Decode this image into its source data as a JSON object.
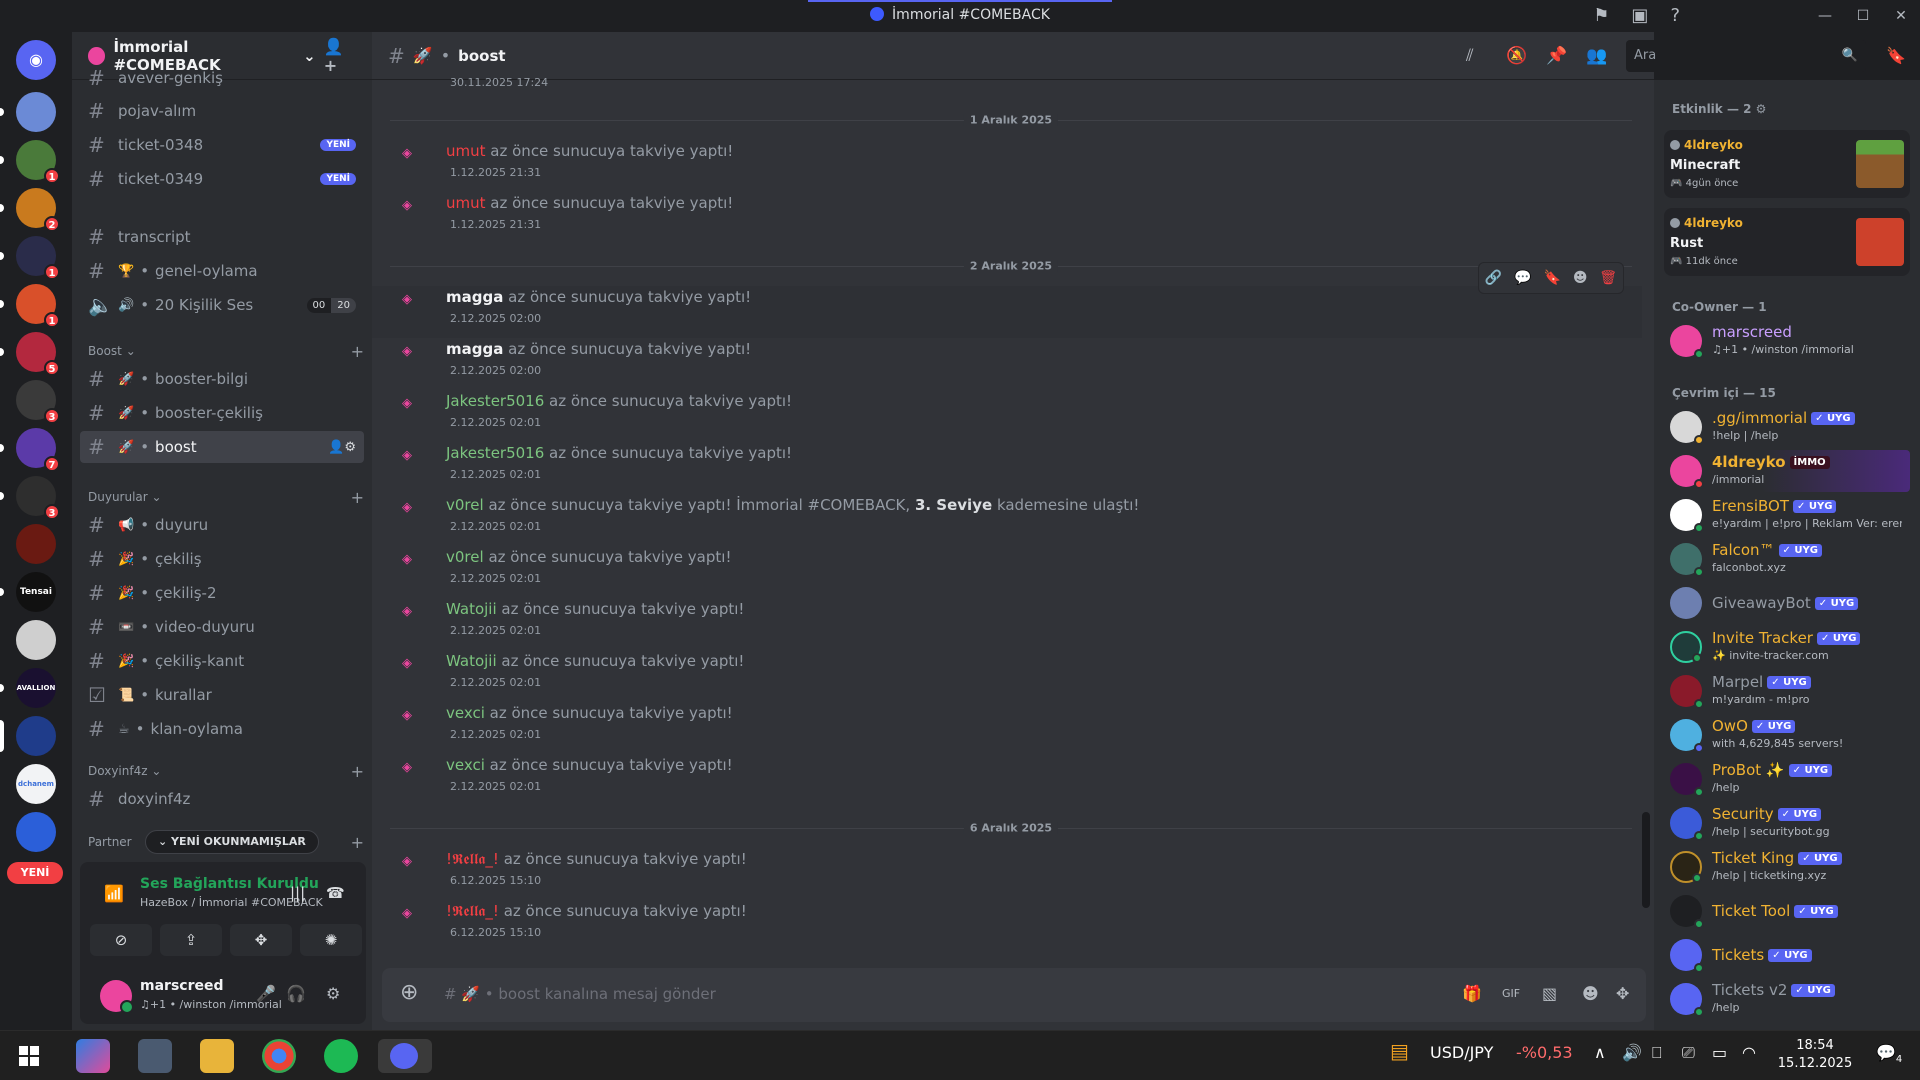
{
  "window": {
    "title": "İmmorial #COMEBACK"
  },
  "rail": {
    "badges": [
      "1",
      "2",
      "1",
      "1",
      "5",
      "3",
      "7",
      "3"
    ],
    "server_labels": [
      "Tensai",
      "AVALLION",
      "dchanem"
    ],
    "new_label": "YENİ"
  },
  "guild": {
    "name": "İmmorial #COMEBACK"
  },
  "channels": {
    "top_partial": "avever-genkiş",
    "items": [
      {
        "name": "pojav-alım"
      },
      {
        "name": "ticket-0348",
        "badge": "YENİ"
      },
      {
        "name": "ticket-0349",
        "badge": "YENİ"
      },
      {
        "name": "transcript"
      },
      {
        "name": "genel-oylama",
        "emoji": "🏆"
      },
      {
        "name": "20 Kişilik Ses",
        "emoji": "🔊",
        "vc_left": "00",
        "vc_right": "20"
      },
      {
        "name": "booster-bilgi",
        "emoji": "🚀"
      },
      {
        "name": "booster-çekiliş",
        "emoji": "🚀"
      },
      {
        "name": "boost",
        "emoji": "🚀"
      },
      {
        "name": "duyuru",
        "emoji": "📢"
      },
      {
        "name": "çekiliş",
        "emoji": "🎉"
      },
      {
        "name": "çekiliş-2",
        "emoji": "🎉"
      },
      {
        "name": "video-duyuru",
        "emoji": "📼"
      },
      {
        "name": "çekiliş-kanıt",
        "emoji": "🎉"
      },
      {
        "name": "kurallar",
        "emoji": "📜"
      },
      {
        "name": "klan-oylama",
        "emoji": "☕"
      },
      {
        "name": "doxyinf4z"
      }
    ],
    "categories": [
      "Boost",
      "Duyurular",
      "Doxyinf4z",
      "Partner"
    ],
    "unread_pill": "YENİ OKUNMAMIŞLAR"
  },
  "voice": {
    "status": "Ses Bağlantısı Kuruldu",
    "location": "HazeBox / İmmorial #COMEBACK"
  },
  "user": {
    "name": "marscreed",
    "status": "♫+1 • /winston /immorial"
  },
  "chat": {
    "channel": "boost",
    "search_placeholder": "Ara",
    "top_partial_ts": "30.11.2025 17:24",
    "dividers": [
      "1 Aralık 2025",
      "2 Aralık 2025",
      "6 Aralık 2025"
    ],
    "action_text": "az önce sunucuya takviye yaptı!",
    "level_text_1": "az önce sunucuya takviye yaptı! İmmorial #COMEBACK,",
    "level_bold": "3. Seviye",
    "level_text_2": "kademesine ulaştı!",
    "messages": [
      {
        "user": "umut",
        "color": "#f23f43",
        "ts": "1.12.2025 21:31"
      },
      {
        "user": "umut",
        "color": "#f23f43",
        "ts": "1.12.2025 21:31"
      },
      {
        "user": "magga",
        "color": "#f2f3f5",
        "ts": "2.12.2025 02:00"
      },
      {
        "user": "magga",
        "color": "#f2f3f5",
        "ts": "2.12.2025 02:00"
      },
      {
        "user": "Jakester5016",
        "color": "#7cc47f",
        "ts": "2.12.2025 02:01"
      },
      {
        "user": "Jakester5016",
        "color": "#7cc47f",
        "ts": "2.12.2025 02:01"
      },
      {
        "user": "v0rel",
        "color": "#7cc47f",
        "ts": "2.12.2025 02:01"
      },
      {
        "user": "v0rel",
        "color": "#7cc47f",
        "ts": "2.12.2025 02:01"
      },
      {
        "user": "Watojii",
        "color": "#7cc47f",
        "ts": "2.12.2025 02:01"
      },
      {
        "user": "Watojii",
        "color": "#7cc47f",
        "ts": "2.12.2025 02:01"
      },
      {
        "user": "vexci",
        "color": "#7cc47f",
        "ts": "2.12.2025 02:01"
      },
      {
        "user": "vexci",
        "color": "#7cc47f",
        "ts": "2.12.2025 02:01"
      },
      {
        "user": "!𝕽𝖊𝖑𝖑𝖆_!",
        "color": "#f23f43",
        "ts": "6.12.2025 15:10"
      },
      {
        "user": "!𝕽𝖊𝖑𝖑𝖆_!",
        "color": "#f23f43",
        "ts": "6.12.2025 15:10"
      }
    ],
    "composer_placeholder": "boost kanalına mesaj gönder"
  },
  "members": {
    "activity_header": "Etkinlik — 2",
    "activities": [
      {
        "user": "4ldreyko",
        "game": "Minecraft",
        "time": "4gün önce"
      },
      {
        "user": "4ldreyko",
        "game": "Rust",
        "time": "11dk önce"
      }
    ],
    "coowner_header": "Co-Owner — 1",
    "coowner": {
      "name": "marscreed",
      "status": "♫+1 • /winston /immorial"
    },
    "online_header": "Çevrim içi — 15",
    "list": [
      {
        "name": ".gg/immorial",
        "tag": "✓ UYG",
        "status": "!help | /help",
        "color": "#f0b232"
      },
      {
        "name": "4ldreyko",
        "tag": "İMMO",
        "status": "/immorial",
        "color": "#f0b232"
      },
      {
        "name": "ErensiBOT",
        "tag": "✓ UYG",
        "status": "e!yardım | e!pro | Reklam Ver: eren...",
        "color": "#f0b232"
      },
      {
        "name": "Falcon™",
        "tag": "✓ UYG",
        "status": "falconbot.xyz",
        "color": "#f0b232"
      },
      {
        "name": "GiveawayBot",
        "tag": "✓ UYG",
        "status": "",
        "color": "#949ba4"
      },
      {
        "name": "Invite Tracker",
        "tag": "✓ UYG",
        "status": "✨ invite-tracker.com",
        "color": "#f0b232"
      },
      {
        "name": "Marpel",
        "tag": "✓ UYG",
        "status": "m!yardım - m!pro",
        "color": "#949ba4"
      },
      {
        "name": "OwO",
        "tag": "✓ UYG",
        "status": "with 4,629,845 servers!",
        "color": "#f0b232"
      },
      {
        "name": "ProBot ✨",
        "tag": "✓ UYG",
        "status": "/help",
        "color": "#f0b232"
      },
      {
        "name": "Security",
        "tag": "✓ UYG",
        "status": "/help | securitybot.gg",
        "color": "#f0b232"
      },
      {
        "name": "Ticket King",
        "tag": "✓ UYG",
        "status": "/help | ticketking.xyz",
        "color": "#f0b232"
      },
      {
        "name": "Ticket Tool",
        "tag": "✓ UYG",
        "status": "",
        "color": "#f0b232"
      },
      {
        "name": "Tickets",
        "tag": "✓ UYG",
        "status": "",
        "color": "#f0b232"
      },
      {
        "name": "Tickets v2",
        "tag": "✓ UYG",
        "status": "/help",
        "color": "#949ba4"
      }
    ]
  },
  "taskbar": {
    "ticker": "USD/JPY",
    "ticker_change": "-%0,53",
    "time": "18:54",
    "date": "15.12.2025",
    "notif_count": "4"
  }
}
